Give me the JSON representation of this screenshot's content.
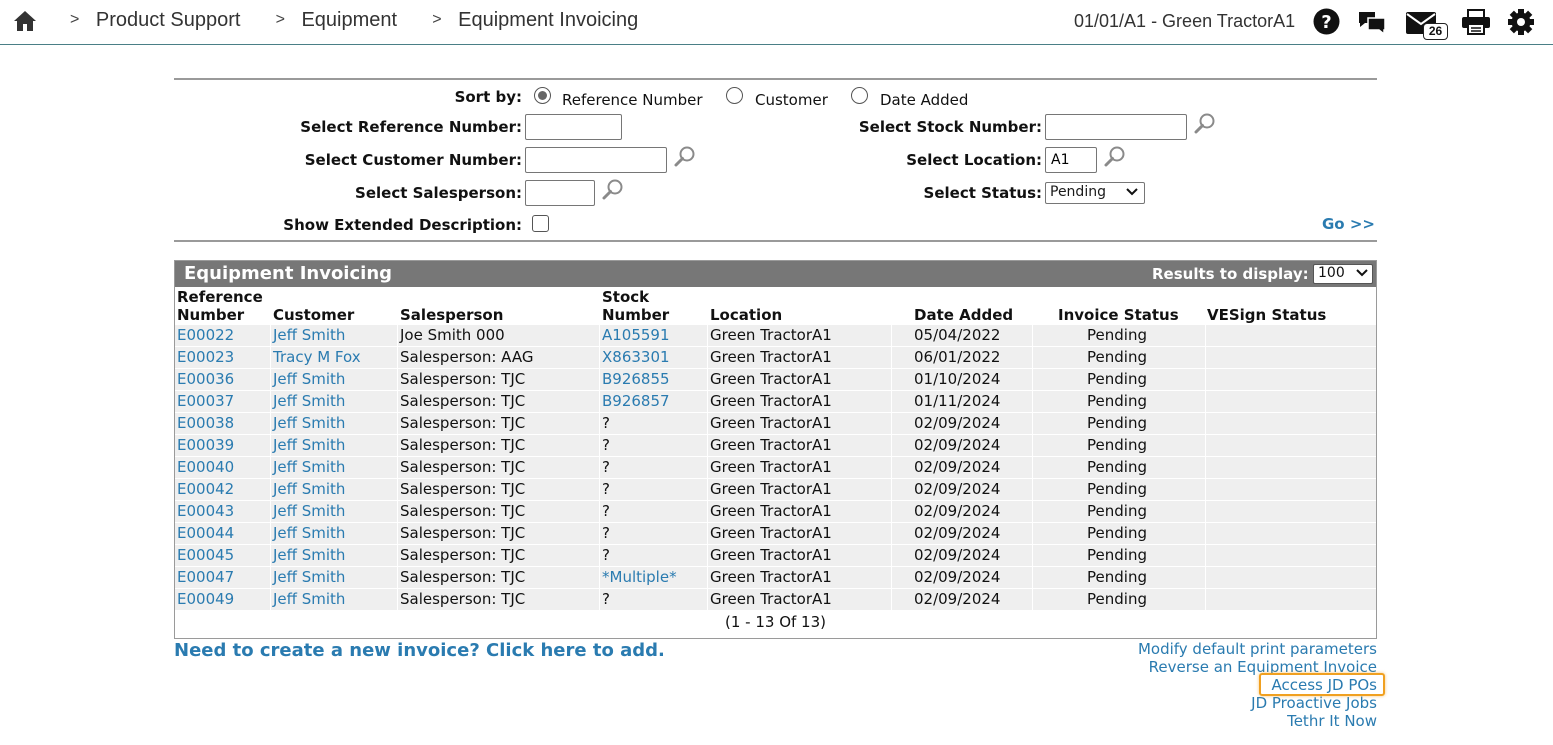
{
  "breadcrumb": {
    "separator": ">",
    "items": [
      "Product Support",
      "Equipment",
      "Equipment Invoicing"
    ]
  },
  "header": {
    "dealer": "01/01/A1 - Green TractorA1",
    "message_count": "26",
    "icons": [
      "home-icon",
      "help-icon",
      "chat-icon",
      "mail-icon",
      "print-icon",
      "gear-icon"
    ]
  },
  "filters": {
    "sort_by_label": "Sort by:",
    "sort_options": [
      "Reference Number",
      "Customer",
      "Date Added"
    ],
    "sort_selected": "Reference Number",
    "reference_label": "Select Reference Number:",
    "reference_value": "",
    "customer_label": "Select Customer Number:",
    "customer_value": "",
    "salesperson_label": "Select Salesperson:",
    "salesperson_value": "",
    "extended_label": "Show Extended Description:",
    "stock_label": "Select Stock Number:",
    "stock_value": "",
    "location_label": "Select Location:",
    "location_value": "A1",
    "status_label": "Select Status:",
    "status_value": "Pending",
    "go_label": "Go >>"
  },
  "results": {
    "title": "Equipment Invoicing",
    "display_label": "Results to display:",
    "display_value": "100",
    "columns": {
      "ref_line1": "Reference",
      "ref_line2": "Number",
      "customer": "Customer",
      "salesperson": "Salesperson",
      "stock_line1": "Stock",
      "stock_line2": "Number",
      "location": "Location",
      "date_added": "Date Added",
      "invoice_status": "Invoice Status",
      "vesign_status": "VESign Status"
    },
    "rows": [
      {
        "ref": "E00022",
        "customer": "Jeff Smith",
        "salesperson": "Joe Smith 000",
        "stock": "A105591",
        "location": "Green TractorA1",
        "date": "05/04/2022",
        "status": "Pending",
        "vesign": ""
      },
      {
        "ref": "E00023",
        "customer": "Tracy M Fox",
        "salesperson": "Salesperson: AAG",
        "stock": "X863301",
        "location": "Green TractorA1",
        "date": "06/01/2022",
        "status": "Pending",
        "vesign": ""
      },
      {
        "ref": "E00036",
        "customer": "Jeff Smith",
        "salesperson": "Salesperson: TJC",
        "stock": "B926855",
        "location": "Green TractorA1",
        "date": "01/10/2024",
        "status": "Pending",
        "vesign": ""
      },
      {
        "ref": "E00037",
        "customer": "Jeff Smith",
        "salesperson": "Salesperson: TJC",
        "stock": "B926857",
        "location": "Green TractorA1",
        "date": "01/11/2024",
        "status": "Pending",
        "vesign": ""
      },
      {
        "ref": "E00038",
        "customer": "Jeff Smith",
        "salesperson": "Salesperson: TJC",
        "stock": "?",
        "location": "Green TractorA1",
        "date": "02/09/2024",
        "status": "Pending",
        "vesign": ""
      },
      {
        "ref": "E00039",
        "customer": "Jeff Smith",
        "salesperson": "Salesperson: TJC",
        "stock": "?",
        "location": "Green TractorA1",
        "date": "02/09/2024",
        "status": "Pending",
        "vesign": ""
      },
      {
        "ref": "E00040",
        "customer": "Jeff Smith",
        "salesperson": "Salesperson: TJC",
        "stock": "?",
        "location": "Green TractorA1",
        "date": "02/09/2024",
        "status": "Pending",
        "vesign": ""
      },
      {
        "ref": "E00042",
        "customer": "Jeff Smith",
        "salesperson": "Salesperson: TJC",
        "stock": "?",
        "location": "Green TractorA1",
        "date": "02/09/2024",
        "status": "Pending",
        "vesign": ""
      },
      {
        "ref": "E00043",
        "customer": "Jeff Smith",
        "salesperson": "Salesperson: TJC",
        "stock": "?",
        "location": "Green TractorA1",
        "date": "02/09/2024",
        "status": "Pending",
        "vesign": ""
      },
      {
        "ref": "E00044",
        "customer": "Jeff Smith",
        "salesperson": "Salesperson: TJC",
        "stock": "?",
        "location": "Green TractorA1",
        "date": "02/09/2024",
        "status": "Pending",
        "vesign": ""
      },
      {
        "ref": "E00045",
        "customer": "Jeff Smith",
        "salesperson": "Salesperson: TJC",
        "stock": "?",
        "location": "Green TractorA1",
        "date": "02/09/2024",
        "status": "Pending",
        "vesign": ""
      },
      {
        "ref": "E00047",
        "customer": "Jeff Smith",
        "salesperson": "Salesperson: TJC",
        "stock": "*Multiple*",
        "location": "Green TractorA1",
        "date": "02/09/2024",
        "status": "Pending",
        "vesign": ""
      },
      {
        "ref": "E00049",
        "customer": "Jeff Smith",
        "salesperson": "Salesperson: TJC",
        "stock": "?",
        "location": "Green TractorA1",
        "date": "02/09/2024",
        "status": "Pending",
        "vesign": ""
      }
    ],
    "pager": "(1  -  13  Of  13)"
  },
  "links": {
    "new_invoice": "Need to create a new invoice? Click here to add.",
    "modify_print": "Modify default print parameters",
    "reverse_invoice": "Reverse an Equipment Invoice",
    "access_jd_pos": "Access JD POs",
    "jd_proactive": "JD Proactive Jobs",
    "tethr": "Tethr It Now"
  },
  "colors": {
    "link": "#2a7bb0",
    "header_bar": "#777777",
    "row_bg": "#efefef",
    "highlight": "#f0a020"
  }
}
